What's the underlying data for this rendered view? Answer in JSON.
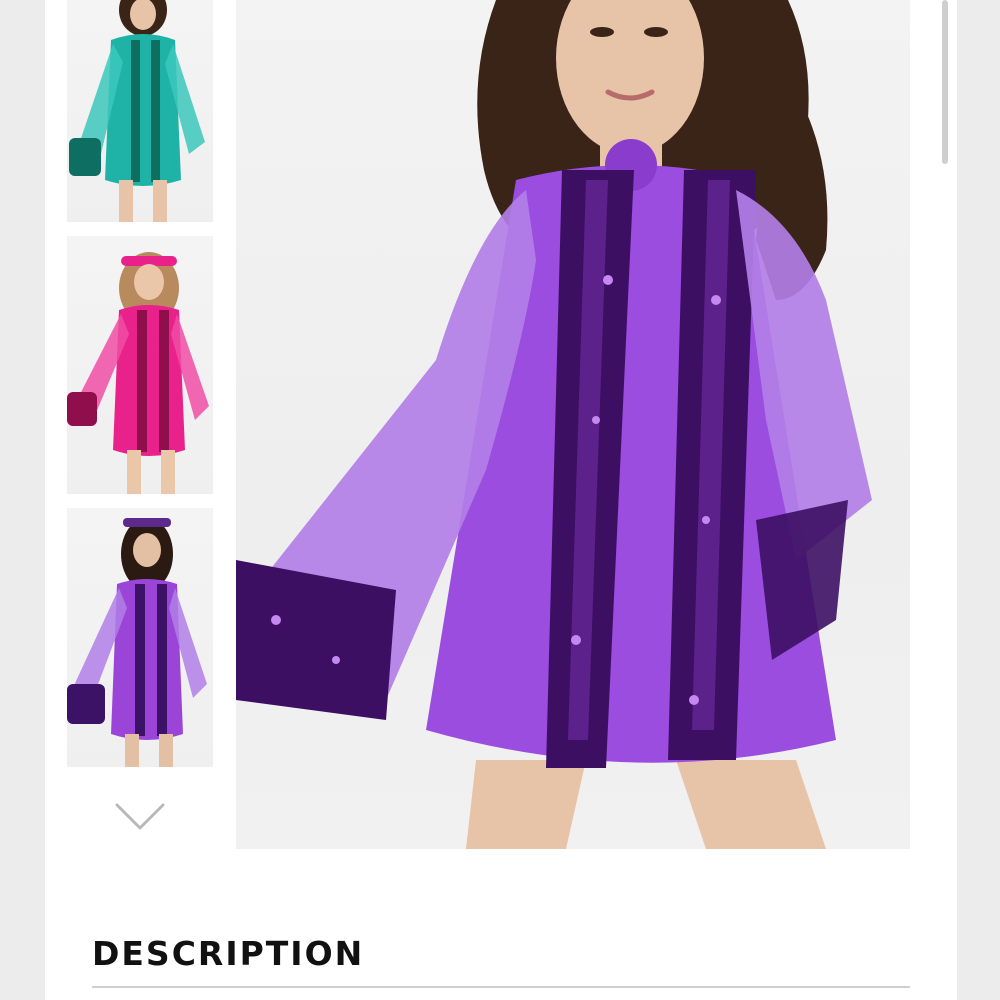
{
  "gallery": {
    "thumbnails": [
      {
        "color_name": "teal",
        "dress_color": "#1fb3a8",
        "sequin_color": "#0f6e62"
      },
      {
        "color_name": "pink",
        "dress_color": "#e8228a",
        "sequin_color": "#8e0f4c"
      },
      {
        "color_name": "purple",
        "dress_color": "#9a45d8",
        "sequin_color": "#3b1266"
      }
    ],
    "next_icon": "chevron-down-icon"
  },
  "main_image": {
    "dress_color": "#9b4de0",
    "sleeve_color": "#b27fe6",
    "sequin_color": "#3c0f63",
    "sequin_highlight": "#c488f0",
    "hair_color": "#3a2418",
    "skin_color": "#e7c3a8"
  },
  "description": {
    "heading": "DESCRIPTION"
  }
}
